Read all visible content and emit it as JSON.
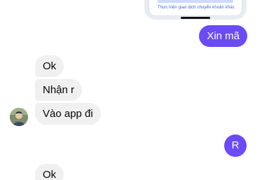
{
  "image_preview": {
    "caption": "Thực hiện giao dịch chuyển khoản khác"
  },
  "messages": [
    {
      "direction": "outgoing",
      "text": "Xin mã"
    },
    {
      "direction": "incoming",
      "text": "Ok"
    },
    {
      "direction": "incoming",
      "text": "Nhận r"
    },
    {
      "direction": "incoming",
      "text": "Vào app đi"
    },
    {
      "direction": "outgoing",
      "text": "R"
    },
    {
      "direction": "incoming",
      "text": "Ok"
    }
  ],
  "colors": {
    "outgoing_bubble": "#6a4bf5",
    "incoming_bubble": "#f0f0f0",
    "background": "#ffffff"
  },
  "icons": {
    "avatar": "contact-avatar"
  }
}
